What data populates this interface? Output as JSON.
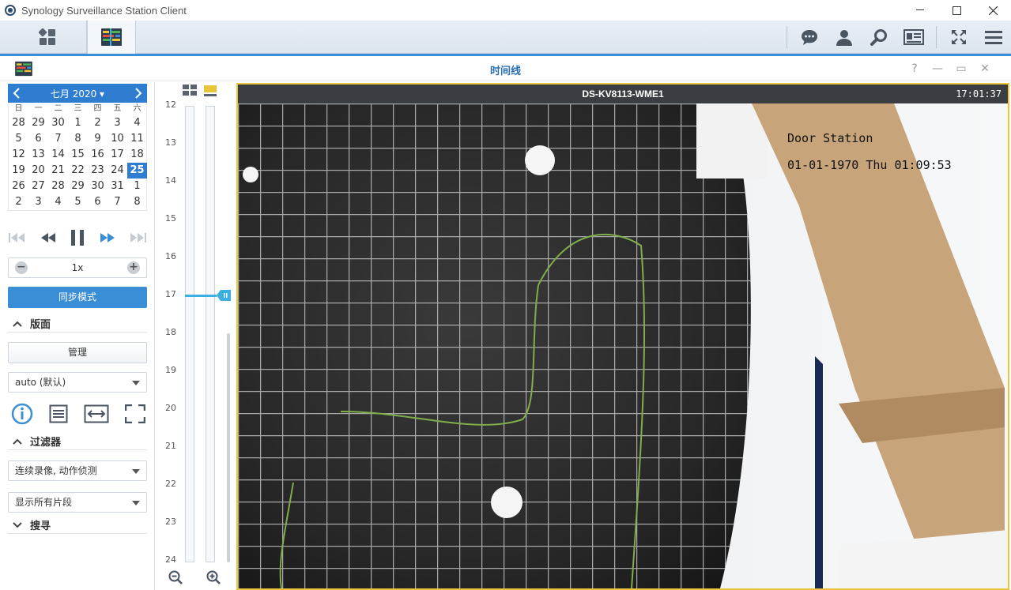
{
  "window": {
    "title": "Synology Surveillance Station Client"
  },
  "subheader": {
    "title": "时间线",
    "help": "?",
    "minimize": "—",
    "restore": "▭",
    "close": "✕"
  },
  "calendar": {
    "month_label": "七月 2020 ▾",
    "weekdays": [
      "日",
      "一",
      "二",
      "三",
      "四",
      "五",
      "六"
    ],
    "days": [
      [
        "28",
        "29",
        "30",
        "1",
        "2",
        "3",
        "4"
      ],
      [
        "5",
        "6",
        "7",
        "8",
        "9",
        "10",
        "11"
      ],
      [
        "12",
        "13",
        "14",
        "15",
        "16",
        "17",
        "18"
      ],
      [
        "19",
        "20",
        "21",
        "22",
        "23",
        "24",
        "25"
      ],
      [
        "26",
        "27",
        "28",
        "29",
        "30",
        "31",
        "1"
      ],
      [
        "2",
        "3",
        "4",
        "5",
        "6",
        "7",
        "8"
      ]
    ],
    "selected": "25"
  },
  "playback": {
    "speed": "1x",
    "minus": "−",
    "plus": "+"
  },
  "sync_button": "同步模式",
  "layout_section": {
    "label": "版面",
    "manage_button": "管理",
    "layout_select": "auto (默认)"
  },
  "filter_section": {
    "label": "过滤器",
    "record_select": "连续录像, 动作侦测",
    "clip_select": "显示所有片段"
  },
  "search_section": {
    "label": "搜寻"
  },
  "timeline": {
    "hours": [
      "12",
      "13",
      "14",
      "15",
      "16",
      "17",
      "18",
      "19",
      "20",
      "21",
      "22",
      "23",
      "24"
    ],
    "current_hour": "17"
  },
  "video": {
    "camera_name": "DS-KV8113-WME1",
    "time": "17:01:37",
    "osd_name": "Door Station",
    "osd_datetime": "01-01-1970 Thu 01:09:53"
  }
}
